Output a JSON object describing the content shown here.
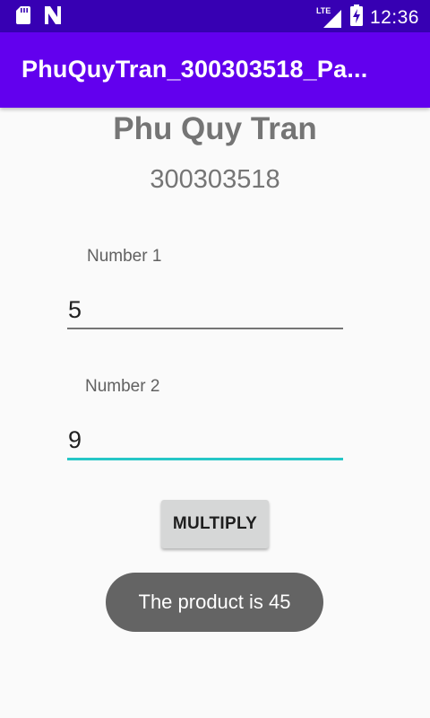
{
  "status_bar": {
    "time": "12:36",
    "network_label": "LTE",
    "icons": [
      "sd-card-icon",
      "notification-n-icon",
      "lte-signal-icon",
      "battery-charging-icon"
    ]
  },
  "app_bar": {
    "title": "PhuQuyTran_300303518_Pa..."
  },
  "header": {
    "name": "Phu Quy Tran",
    "student_id": "300303518"
  },
  "form": {
    "number1": {
      "label": "Number 1",
      "value": "5"
    },
    "number2": {
      "label": "Number 2",
      "value": "9"
    },
    "multiply_label": "MULTIPLY"
  },
  "toast": {
    "message": "The product is 45"
  },
  "colors": {
    "status_bar": "#3700b3",
    "app_bar": "#6200ee",
    "accent_underline": "#26c6c6",
    "toast_bg": "#646464",
    "button_bg": "#d6d7d7"
  }
}
